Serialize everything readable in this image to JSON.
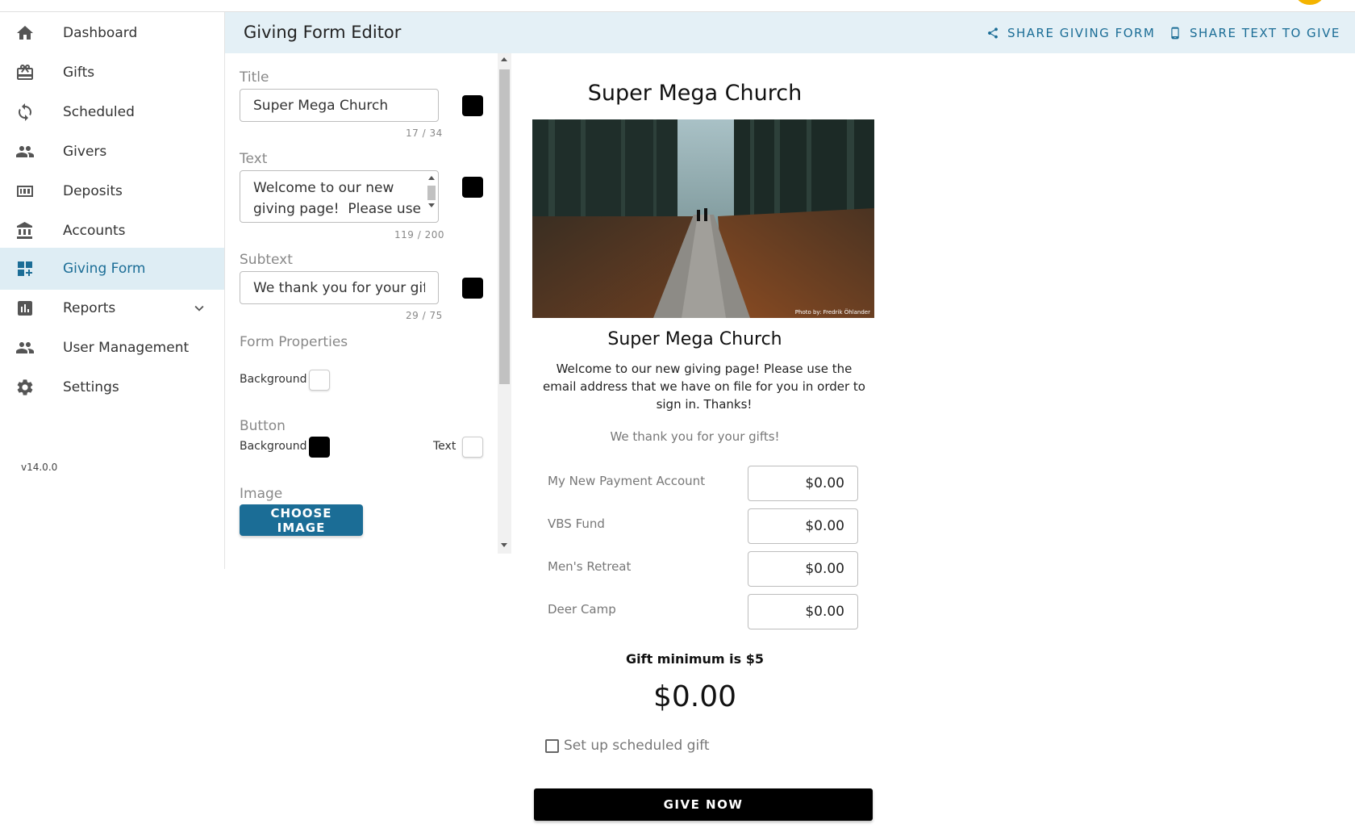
{
  "sidebar": {
    "items": [
      {
        "label": "Dashboard",
        "icon": "home-icon"
      },
      {
        "label": "Gifts",
        "icon": "gift-card-icon"
      },
      {
        "label": "Scheduled",
        "icon": "recurring-icon"
      },
      {
        "label": "Givers",
        "icon": "people-icon"
      },
      {
        "label": "Deposits",
        "icon": "deposit-icon"
      },
      {
        "label": "Accounts",
        "icon": "bank-icon"
      },
      {
        "label": "Giving Form",
        "icon": "dashboard-add-icon",
        "active": true
      },
      {
        "label": "Reports",
        "icon": "bar-chart-icon",
        "has_submenu": true
      },
      {
        "label": "User Management",
        "icon": "people-icon"
      },
      {
        "label": "Settings",
        "icon": "gear-icon"
      }
    ],
    "version": "v14.0.0"
  },
  "header": {
    "title": "Giving Form Editor",
    "share_form_label": "SHARE GIVING FORM",
    "share_text_label": "SHARE TEXT TO GIVE"
  },
  "editor": {
    "title_label": "Title",
    "title_value": "Super Mega Church",
    "title_counter": "17 / 34",
    "text_label": "Text",
    "text_value": "Welcome to our new giving page!  Please use the email address that we have on file for you in order to sign in. Thanks!",
    "text_counter": "119 / 200",
    "subtext_label": "Subtext",
    "subtext_value": "We thank you for your gifts!",
    "subtext_counter": "29 / 75",
    "form_properties_label": "Form Properties",
    "form_background_label": "Background",
    "button_label": "Button",
    "button_background_label": "Background",
    "button_text_label": "Text",
    "image_label": "Image",
    "choose_image_label": "CHOOSE IMAGE"
  },
  "colors": {
    "accent": "#1b6d96",
    "active_bg": "#deedf4",
    "header_bg": "#e4f0f6",
    "title_color": "#000000",
    "text_color": "#000000",
    "subtext_color": "#000000",
    "form_background": "#ffffff",
    "button_background": "#000000",
    "button_text": "#ffffff"
  },
  "preview": {
    "title": "Super Mega Church",
    "image_credit": "Photo by: Fredrik Öhlander",
    "heading": "Super Mega Church",
    "text": "Welcome to our new giving page! Please use the email address that we have on file for you in order to sign in. Thanks!",
    "subtext": "We thank you for your gifts!",
    "funds": [
      {
        "name": "My New Payment Account",
        "amount": "$0.00"
      },
      {
        "name": "VBS Fund",
        "amount": "$0.00"
      },
      {
        "name": "Men's Retreat",
        "amount": "$0.00"
      },
      {
        "name": "Deer Camp",
        "amount": "$0.00"
      }
    ],
    "gift_minimum": "Gift minimum is $5",
    "total": "$0.00",
    "scheduled_label": "Set up scheduled gift",
    "give_button": "GIVE NOW"
  }
}
